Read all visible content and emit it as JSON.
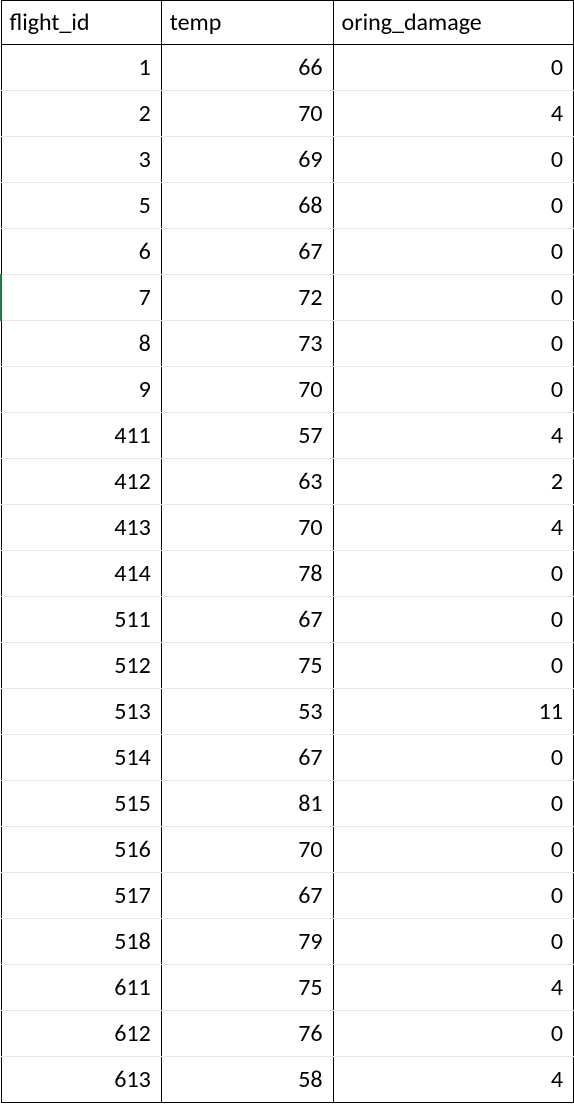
{
  "columns": [
    "flight_id",
    "temp",
    "oring_damage"
  ],
  "rows": [
    {
      "flight_id": 1,
      "temp": 66,
      "oring_damage": 0
    },
    {
      "flight_id": 2,
      "temp": 70,
      "oring_damage": 4
    },
    {
      "flight_id": 3,
      "temp": 69,
      "oring_damage": 0
    },
    {
      "flight_id": 5,
      "temp": 68,
      "oring_damage": 0
    },
    {
      "flight_id": 6,
      "temp": 67,
      "oring_damage": 0
    },
    {
      "flight_id": 7,
      "temp": 72,
      "oring_damage": 0,
      "selected": true
    },
    {
      "flight_id": 8,
      "temp": 73,
      "oring_damage": 0
    },
    {
      "flight_id": 9,
      "temp": 70,
      "oring_damage": 0
    },
    {
      "flight_id": 411,
      "temp": 57,
      "oring_damage": 4
    },
    {
      "flight_id": 412,
      "temp": 63,
      "oring_damage": 2
    },
    {
      "flight_id": 413,
      "temp": 70,
      "oring_damage": 4
    },
    {
      "flight_id": 414,
      "temp": 78,
      "oring_damage": 0
    },
    {
      "flight_id": 511,
      "temp": 67,
      "oring_damage": 0
    },
    {
      "flight_id": 512,
      "temp": 75,
      "oring_damage": 0
    },
    {
      "flight_id": 513,
      "temp": 53,
      "oring_damage": 11
    },
    {
      "flight_id": 514,
      "temp": 67,
      "oring_damage": 0
    },
    {
      "flight_id": 515,
      "temp": 81,
      "oring_damage": 0
    },
    {
      "flight_id": 516,
      "temp": 70,
      "oring_damage": 0
    },
    {
      "flight_id": 517,
      "temp": 67,
      "oring_damage": 0
    },
    {
      "flight_id": 518,
      "temp": 79,
      "oring_damage": 0
    },
    {
      "flight_id": 611,
      "temp": 75,
      "oring_damage": 4
    },
    {
      "flight_id": 612,
      "temp": 76,
      "oring_damage": 0
    },
    {
      "flight_id": 613,
      "temp": 58,
      "oring_damage": 4
    }
  ]
}
